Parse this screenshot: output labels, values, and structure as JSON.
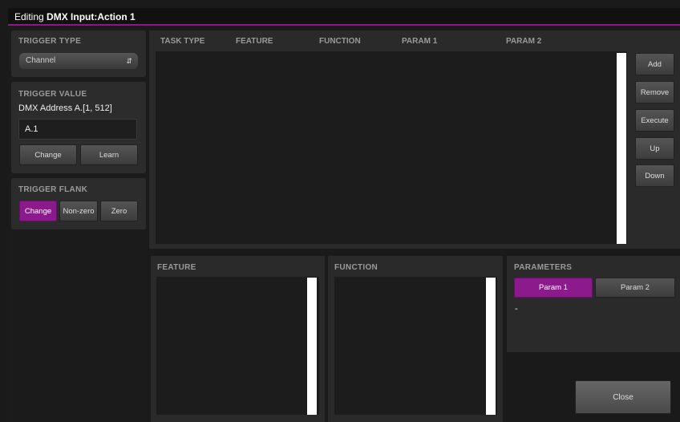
{
  "window": {
    "title_prefix": "Editing ",
    "title_bold": "DMX Input:Action 1"
  },
  "trigger_type": {
    "title": "TRIGGER TYPE",
    "selected": "Channel"
  },
  "trigger_value": {
    "title": "TRIGGER VALUE",
    "label": "DMX Address A.[1, 512]",
    "value": "A.1",
    "change_label": "Change",
    "learn_label": "Learn"
  },
  "trigger_flank": {
    "title": "TRIGGER FLANK",
    "options": [
      {
        "label": "Change",
        "active": true
      },
      {
        "label": "Non-zero",
        "active": false
      },
      {
        "label": "Zero",
        "active": false
      }
    ]
  },
  "task_table": {
    "columns": [
      "TASK TYPE",
      "FEATURE",
      "FUNCTION",
      "PARAM 1",
      "PARAM 2"
    ]
  },
  "task_buttons": [
    "Add",
    "Remove",
    "Execute",
    "Up",
    "Down"
  ],
  "feature": {
    "title": "FEATURE"
  },
  "function": {
    "title": "FUNCTION"
  },
  "parameters": {
    "title": "PARAMETERS",
    "tabs": [
      {
        "label": "Param 1",
        "active": true
      },
      {
        "label": "Param 2",
        "active": false
      }
    ],
    "value": "-"
  },
  "close_label": "Close",
  "colors": {
    "accent": "#8c1a8c",
    "panel": "#2c2c2c",
    "background": "#1a1a1a"
  }
}
